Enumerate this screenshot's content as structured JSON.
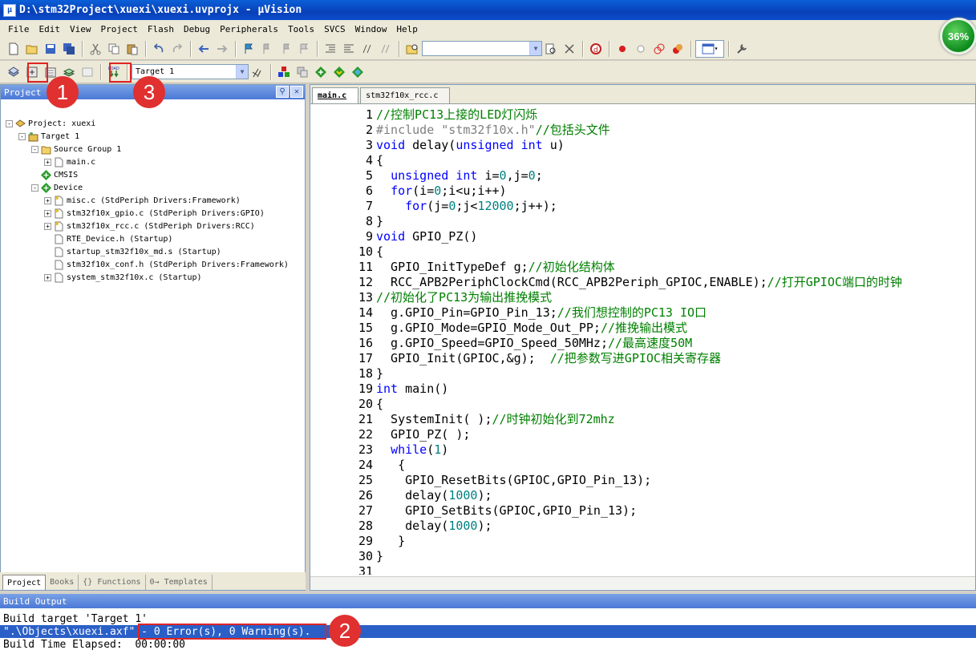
{
  "window": {
    "title": "D:\\stm32Project\\xuexi\\xuexi.uvprojx - µVision",
    "progress_badge": "36%"
  },
  "menu": [
    "File",
    "Edit",
    "View",
    "Project",
    "Flash",
    "Debug",
    "Peripherals",
    "Tools",
    "SVCS",
    "Window",
    "Help"
  ],
  "toolbar2": {
    "target_combo": "Target 1"
  },
  "project_panel": {
    "title": "Project",
    "tree": [
      {
        "label": "Project: xuexi",
        "level": 0,
        "expander": "-",
        "icon": "project"
      },
      {
        "label": "Target 1",
        "level": 1,
        "expander": "-",
        "icon": "target"
      },
      {
        "label": "Source Group 1",
        "level": 2,
        "expander": "-",
        "icon": "folder"
      },
      {
        "label": "main.c",
        "level": 3,
        "expander": "+",
        "icon": "file"
      },
      {
        "label": "CMSIS",
        "level": 2,
        "expander": "",
        "icon": "diamond"
      },
      {
        "label": "Device",
        "level": 2,
        "expander": "-",
        "icon": "diamond"
      },
      {
        "label": "misc.c (StdPeriph Drivers:Framework)",
        "level": 3,
        "expander": "+",
        "icon": "filekey"
      },
      {
        "label": "stm32f10x_gpio.c (StdPeriph Drivers:GPIO)",
        "level": 3,
        "expander": "+",
        "icon": "filekey"
      },
      {
        "label": "stm32f10x_rcc.c (StdPeriph Drivers:RCC)",
        "level": 3,
        "expander": "+",
        "icon": "filekey"
      },
      {
        "label": "RTE_Device.h (Startup)",
        "level": 3,
        "expander": "",
        "icon": "file"
      },
      {
        "label": "startup_stm32f10x_md.s (Startup)",
        "level": 3,
        "expander": "",
        "icon": "file"
      },
      {
        "label": "stm32f10x_conf.h (StdPeriph Drivers:Framework)",
        "level": 3,
        "expander": "",
        "icon": "file"
      },
      {
        "label": "system_stm32f10x.c (Startup)",
        "level": 3,
        "expander": "+",
        "icon": "file"
      }
    ],
    "tabs": [
      "Project",
      "Books",
      "{} Functions",
      "0→ Templates"
    ]
  },
  "editor": {
    "tabs": [
      "main.c",
      "stm32f10x_rcc.c"
    ],
    "lines": [
      {
        "n": "1",
        "s": [
          [
            "cm",
            "//控制PC13上接的LED灯闪烁"
          ]
        ]
      },
      {
        "n": "2",
        "s": [
          [
            "pp",
            "#include "
          ],
          [
            "st",
            "\"stm32f10x.h\""
          ],
          [
            "cm",
            "//包括头文件"
          ]
        ]
      },
      {
        "n": "3",
        "s": [
          [
            "kw",
            "void"
          ],
          [
            "ct",
            " delay("
          ],
          [
            "kw",
            "unsigned int"
          ],
          [
            "ct",
            " u)"
          ]
        ]
      },
      {
        "n": "4",
        "s": [
          [
            "ct",
            "{"
          ]
        ]
      },
      {
        "n": "5",
        "s": [
          [
            "ct",
            "  "
          ],
          [
            "kw",
            "unsigned int"
          ],
          [
            "ct",
            " i="
          ],
          [
            "nm",
            "0"
          ],
          [
            "ct",
            ",j="
          ],
          [
            "nm",
            "0"
          ],
          [
            "ct",
            ";"
          ]
        ]
      },
      {
        "n": "6",
        "s": [
          [
            "ct",
            "  "
          ],
          [
            "kw",
            "for"
          ],
          [
            "ct",
            "(i="
          ],
          [
            "nm",
            "0"
          ],
          [
            "ct",
            ";i<u;i++)"
          ]
        ]
      },
      {
        "n": "7",
        "s": [
          [
            "ct",
            "    "
          ],
          [
            "kw",
            "for"
          ],
          [
            "ct",
            "(j="
          ],
          [
            "nm",
            "0"
          ],
          [
            "ct",
            ";j<"
          ],
          [
            "nm",
            "12000"
          ],
          [
            "ct",
            ";j++);"
          ]
        ]
      },
      {
        "n": "8",
        "s": [
          [
            "ct",
            "}"
          ]
        ]
      },
      {
        "n": "9",
        "s": [
          [
            "kw",
            "void"
          ],
          [
            "ct",
            " GPIO_PZ()"
          ]
        ]
      },
      {
        "n": "10",
        "s": [
          [
            "ct",
            "{"
          ]
        ]
      },
      {
        "n": "11",
        "s": [
          [
            "ct",
            "  GPIO_InitTypeDef g;"
          ],
          [
            "cm",
            "//初始化结构体"
          ]
        ]
      },
      {
        "n": "12",
        "s": [
          [
            "ct",
            "  RCC_APB2PeriphClockCmd(RCC_APB2Periph_GPIOC,ENABLE);"
          ],
          [
            "cm",
            "//打开GPIOC端口的时钟"
          ]
        ]
      },
      {
        "n": "13",
        "s": [
          [
            "cm",
            "//初始化了PC13为输出推挽模式"
          ]
        ]
      },
      {
        "n": "14",
        "s": [
          [
            "ct",
            "  g.GPIO_Pin=GPIO_Pin_13;"
          ],
          [
            "cm",
            "//我们想控制的PC13 IO口"
          ]
        ]
      },
      {
        "n": "15",
        "s": [
          [
            "ct",
            "  g.GPIO_Mode=GPIO_Mode_Out_PP;"
          ],
          [
            "cm",
            "//推挽输出模式"
          ]
        ]
      },
      {
        "n": "16",
        "s": [
          [
            "ct",
            "  g.GPIO_Speed=GPIO_Speed_50MHz;"
          ],
          [
            "cm",
            "//最高速度50M"
          ]
        ]
      },
      {
        "n": "17",
        "s": [
          [
            "ct",
            "  GPIO_Init(GPIOC,&g);  "
          ],
          [
            "cm",
            "//把参数写进GPIOC相关寄存器"
          ]
        ]
      },
      {
        "n": "18",
        "s": [
          [
            "ct",
            "}"
          ]
        ]
      },
      {
        "n": "19",
        "s": [
          [
            "kw",
            "int"
          ],
          [
            "ct",
            " main()"
          ]
        ]
      },
      {
        "n": "20",
        "s": [
          [
            "ct",
            "{"
          ]
        ]
      },
      {
        "n": "21",
        "s": [
          [
            "ct",
            "  SystemInit( );"
          ],
          [
            "cm",
            "//时钟初始化到72mhz"
          ]
        ]
      },
      {
        "n": "22",
        "s": [
          [
            "ct",
            "  GPIO_PZ( );"
          ]
        ]
      },
      {
        "n": "23",
        "s": [
          [
            "ct",
            "  "
          ],
          [
            "kw",
            "while"
          ],
          [
            "ct",
            "("
          ],
          [
            "nm",
            "1"
          ],
          [
            "ct",
            ")"
          ]
        ]
      },
      {
        "n": "24",
        "s": [
          [
            "ct",
            "   {"
          ]
        ]
      },
      {
        "n": "25",
        "s": [
          [
            "ct",
            "    GPIO_ResetBits(GPIOC,GPIO_Pin_13);"
          ]
        ]
      },
      {
        "n": "26",
        "s": [
          [
            "ct",
            "    delay("
          ],
          [
            "nm",
            "1000"
          ],
          [
            "ct",
            ");"
          ]
        ]
      },
      {
        "n": "27",
        "s": [
          [
            "ct",
            "    GPIO_SetBits(GPIOC,GPIO_Pin_13);"
          ]
        ]
      },
      {
        "n": "28",
        "s": [
          [
            "ct",
            "    delay("
          ],
          [
            "nm",
            "1000"
          ],
          [
            "ct",
            ");"
          ]
        ]
      },
      {
        "n": "29",
        "s": [
          [
            "ct",
            "   }"
          ]
        ]
      },
      {
        "n": "30",
        "s": [
          [
            "ct",
            "}"
          ]
        ]
      },
      {
        "n": "31",
        "s": [
          [
            "ct",
            ""
          ]
        ]
      }
    ]
  },
  "build_output": {
    "title": "Build Output",
    "line1": "Build target 'Target 1'",
    "line2": "\".\\Objects\\xuexi.axf\" - 0 Error(s), 0 Warning(s).",
    "line3": "Build Time Elapsed:  00:00:00"
  },
  "annotations": [
    "1",
    "2",
    "3"
  ],
  "colors": {
    "keyword": "#0000ff",
    "comment": "#008000",
    "number": "#008080",
    "annotation": "#e02424",
    "selection": "#2a5fc7"
  }
}
